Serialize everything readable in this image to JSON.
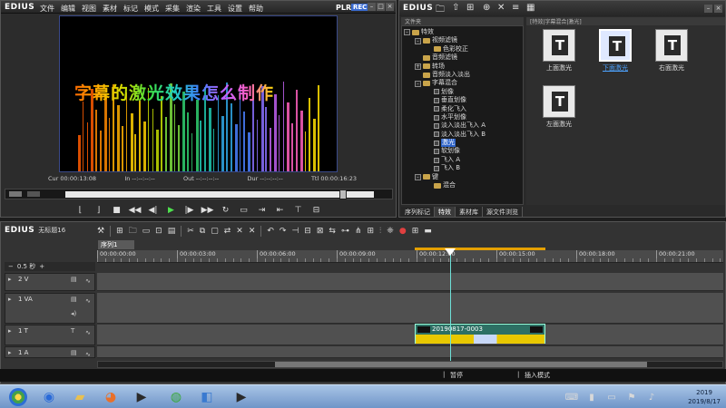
{
  "player": {
    "brand": "EDIUS",
    "menu": [
      "文件",
      "编辑",
      "视图",
      "素材",
      "标记",
      "模式",
      "采集",
      "渲染",
      "工具",
      "设置",
      "帮助"
    ],
    "plr": "PLR",
    "rec": "REC",
    "caption": "字幕的激光效果怎么制作",
    "timecodes": {
      "cur": "Cur 00:00:13:08",
      "in": "In --:--:--:--",
      "out": "Out --:--:--:--",
      "dur": "Dur --:--:--:--",
      "ttl": "Ttl 00:00:16:23"
    },
    "scrub_position": 0.9
  },
  "effects": {
    "brand": "EDIUS",
    "tree_header": "文件夹",
    "browse_header": "[特效|字幕混合|激光]",
    "tree": [
      {
        "label": "特效",
        "level": 0,
        "fold": "-",
        "type": "folder"
      },
      {
        "label": "视频滤镜",
        "level": 1,
        "fold": "-",
        "type": "folder"
      },
      {
        "label": "色彩校正",
        "level": 2,
        "fold": "",
        "type": "folder"
      },
      {
        "label": "音频滤镜",
        "level": 1,
        "fold": "",
        "type": "folder"
      },
      {
        "label": "转场",
        "level": 1,
        "fold": "+",
        "type": "folder"
      },
      {
        "label": "音频淡入淡出",
        "level": 1,
        "fold": "",
        "type": "folder"
      },
      {
        "label": "字幕混合",
        "level": 1,
        "fold": "-",
        "type": "folder"
      },
      {
        "label": "划像",
        "level": 2,
        "fold": "",
        "type": "effect"
      },
      {
        "label": "垂直划像",
        "level": 2,
        "fold": "",
        "type": "effect"
      },
      {
        "label": "柔化飞入",
        "level": 2,
        "fold": "",
        "type": "effect"
      },
      {
        "label": "水平划像",
        "level": 2,
        "fold": "",
        "type": "effect"
      },
      {
        "label": "淡入淡出飞入 A",
        "level": 2,
        "fold": "",
        "type": "effect"
      },
      {
        "label": "淡入淡出飞入 B",
        "level": 2,
        "fold": "",
        "type": "effect"
      },
      {
        "label": "激光",
        "level": 2,
        "fold": "",
        "type": "effect",
        "selected": true
      },
      {
        "label": "软划像",
        "level": 2,
        "fold": "",
        "type": "effect"
      },
      {
        "label": "飞入 A",
        "level": 2,
        "fold": "",
        "type": "effect"
      },
      {
        "label": "飞入 B",
        "level": 2,
        "fold": "",
        "type": "effect"
      },
      {
        "label": "键",
        "level": 1,
        "fold": "-",
        "type": "folder"
      },
      {
        "label": "混合",
        "level": 2,
        "fold": "",
        "type": "folder"
      }
    ],
    "tiles": [
      {
        "label": "上面激光",
        "selected": false
      },
      {
        "label": "下面激光",
        "selected": true
      },
      {
        "label": "右面激光",
        "selected": false
      },
      {
        "label": "左面激光",
        "selected": false
      }
    ],
    "tabs": [
      {
        "label": "序列标记",
        "active": false
      },
      {
        "label": "特效",
        "active": true
      },
      {
        "label": "素材库",
        "active": false
      },
      {
        "label": "源文件浏览",
        "active": false
      }
    ]
  },
  "timeline": {
    "brand": "EDIUS",
    "project": "无标题16",
    "sequence_tab": "序列1",
    "scale": "0.5 秒",
    "ruler_labels": [
      "00:00:00:00",
      "00:00:03:00",
      "00:00:06:00",
      "00:00:09:00",
      "00:00:12:00",
      "00:00:15:00",
      "00:00:18:00",
      "00:00:21:00"
    ],
    "tracks": [
      {
        "name": "2 V",
        "kind": "v"
      },
      {
        "name": "1 VA",
        "kind": "va"
      },
      {
        "name": "1 T",
        "kind": "t"
      },
      {
        "name": "1 A",
        "kind": "a"
      }
    ],
    "clip": {
      "label": "20190817-0003"
    },
    "status": {
      "left": "暂停",
      "right": "插入模式"
    }
  },
  "taskbar": {
    "clock_year": "2019",
    "clock_date": "2019/8/17"
  }
}
